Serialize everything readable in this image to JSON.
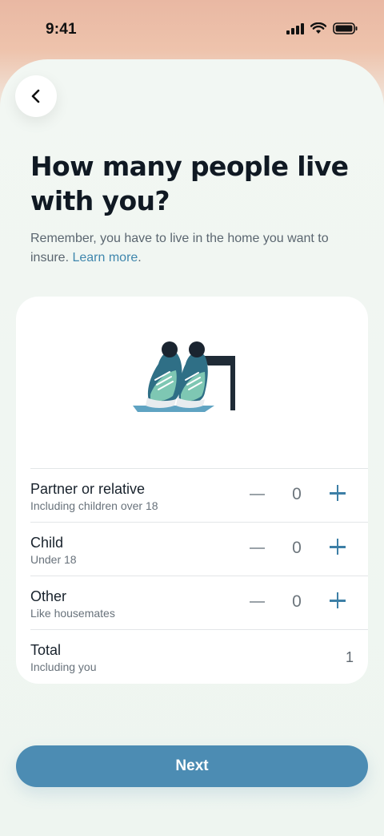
{
  "status_bar": {
    "time": "9:41"
  },
  "page": {
    "title": "How many people live with you?",
    "subtitle_text": "Remember, you have to live in the home you want to insure. ",
    "subtitle_link": "Learn more",
    "subtitle_end": "."
  },
  "household": {
    "rows": [
      {
        "label": "Partner or relative",
        "sublabel": "Including children over 18",
        "count": "0"
      },
      {
        "label": "Child",
        "sublabel": "Under 18",
        "count": "0"
      },
      {
        "label": "Other",
        "sublabel": "Like housemates",
        "count": "0"
      }
    ],
    "total": {
      "label": "Total",
      "sublabel": "Including you",
      "value": "1"
    }
  },
  "footer": {
    "next_label": "Next"
  },
  "colors": {
    "accent": "#4c8cb3",
    "plus": "#3d7fa6",
    "sheet": "#eef5f0"
  }
}
